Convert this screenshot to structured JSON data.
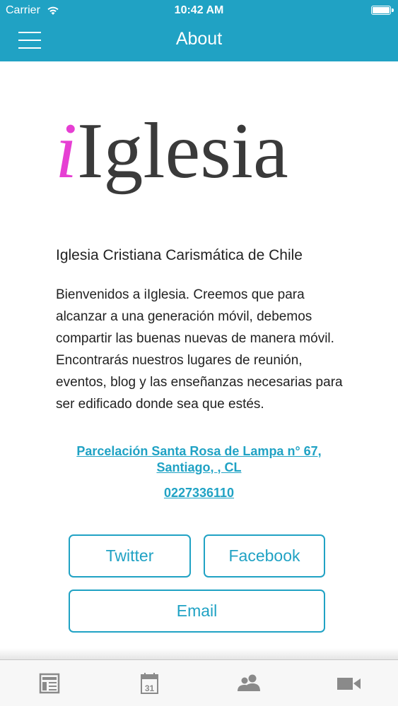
{
  "status_bar": {
    "carrier": "Carrier",
    "time": "10:42 AM"
  },
  "nav": {
    "title": "About",
    "menu_icon": "hamburger-menu-icon"
  },
  "logo": {
    "i": "i",
    "rest": "Iglesia"
  },
  "content": {
    "org_name": "Iglesia Cristiana Carismática de Chile",
    "description": "Bienvenidos a iIglesia. Creemos que para alcanzar a una generación móvil, debemos compartir las buenas nuevas de manera móvil. Encontrarás nuestros lugares de reunión, eventos, blog y las enseñanzas necesarias para ser edificado donde sea que estés.",
    "address_line1": "Parcelación Santa Rosa de Lampa n° 67,",
    "address_line2": "Santiago, , CL",
    "phone": "0227336110"
  },
  "buttons": {
    "twitter": "Twitter",
    "facebook": "Facebook",
    "email": "Email"
  },
  "tab_bar": {
    "tabs": [
      {
        "icon": "news-icon"
      },
      {
        "icon": "calendar-icon",
        "label": "31"
      },
      {
        "icon": "people-icon"
      },
      {
        "icon": "video-camera-icon"
      }
    ]
  },
  "colors": {
    "accent": "#20a2c4",
    "logo_pink": "#e63fd3",
    "logo_gray": "#3a3a3a",
    "tab_icon": "#8a8a8a"
  }
}
